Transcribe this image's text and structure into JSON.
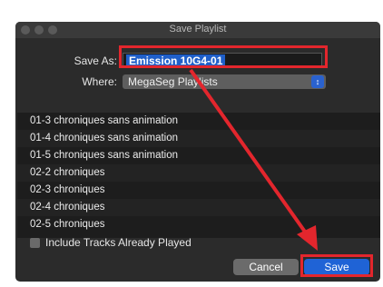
{
  "window": {
    "title": "Save Playlist"
  },
  "form": {
    "save_as_label": "Save As:",
    "save_as_value": "Emission 10G4-01",
    "where_label": "Where:",
    "where_value": "MegaSeg Playlists"
  },
  "list": {
    "items": [
      "01-3 chroniques sans animation",
      "01-4 chroniques sans animation",
      "01-5 chroniques sans animation",
      "02-2 chroniques",
      "02-3 chroniques",
      "02-4 chroniques",
      "02-5 chroniques"
    ]
  },
  "options": {
    "include_played_label": "Include Tracks Already Played"
  },
  "buttons": {
    "cancel": "Cancel",
    "save": "Save"
  },
  "annotation": {
    "color": "#e3262d"
  }
}
